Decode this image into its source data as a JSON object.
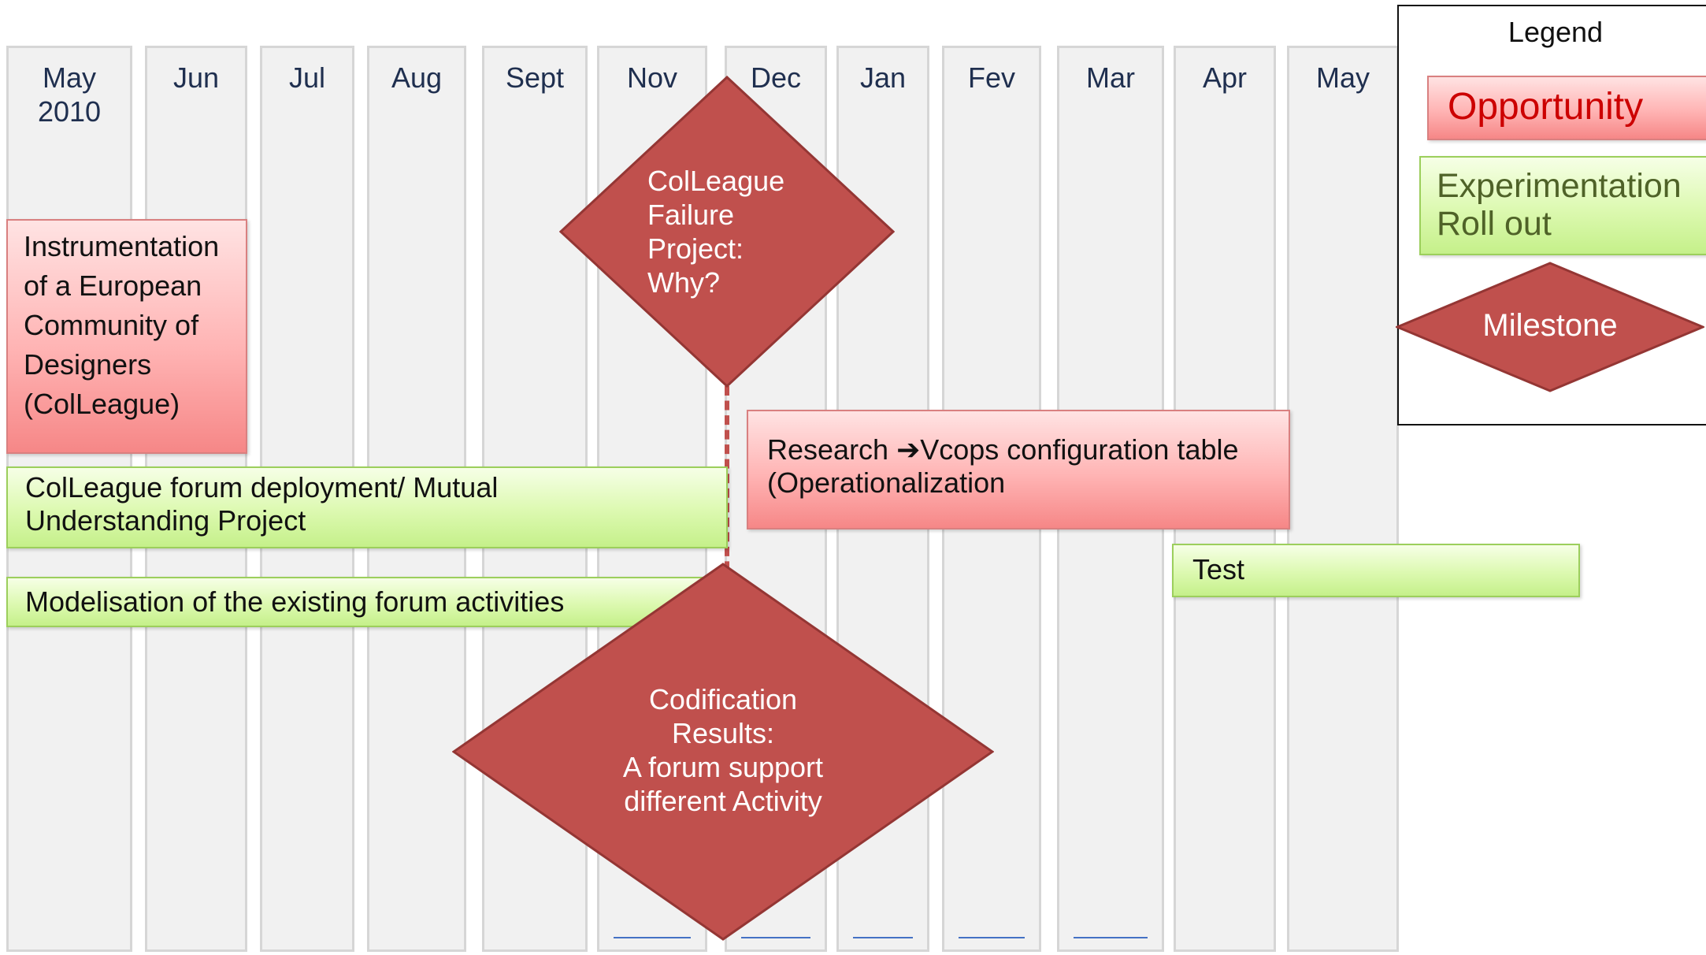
{
  "title": "",
  "timeline": {
    "months": [
      {
        "label": "May\n2010"
      },
      {
        "label": "Jun"
      },
      {
        "label": "Jul"
      },
      {
        "label": "Aug"
      },
      {
        "label": "Sept"
      },
      {
        "label": "Nov"
      },
      {
        "label": "Dec"
      },
      {
        "label": "Jan"
      },
      {
        "label": "Fev"
      },
      {
        "label": "Mar"
      },
      {
        "label": "Apr"
      },
      {
        "label": "May"
      }
    ]
  },
  "opportunities": {
    "instrumentation": "Instrumentation\nof a European\nCommunity of\nDesigners\n(ColLeague)",
    "research": "Research ➔Vcops configuration table\n(Operationalization"
  },
  "experiments": {
    "forum_deployment": "ColLeague forum deployment/ Mutual\nUnderstanding Project",
    "modelisation": "Modelisation of the existing forum activities",
    "test": "Test"
  },
  "milestones": {
    "failure": "ColLeague\nFailure\nProject:\nWhy?",
    "codification": "Codification\nResults:\nA forum support\ndifferent Activity"
  },
  "legend": {
    "title": "Legend",
    "opportunity": "Opportunity",
    "experimentation": "Experimentation\nRoll out",
    "milestone": "Milestone"
  },
  "colors": {
    "milestone_fill": "#c0504d",
    "opportunity_text": "#cc0000",
    "experimentation_text": "#4f6228"
  }
}
